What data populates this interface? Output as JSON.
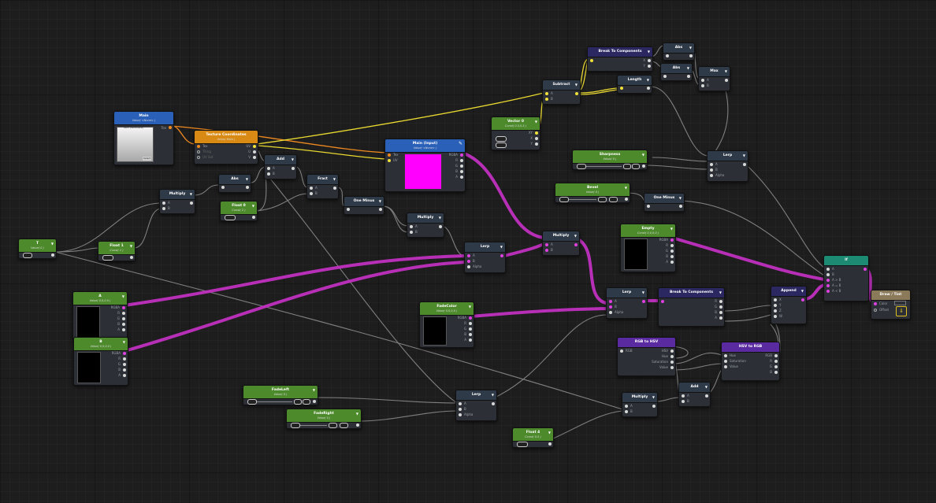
{
  "nodes": {
    "main_texture": {
      "title": "Main",
      "sub": "Value( <None> )",
      "port": "Tex",
      "tex_label": "Item (Texture2D)",
      "btn": "Select"
    },
    "texcoord": {
      "title": "Texture Coordinates",
      "sub": "Value( Main )",
      "p1": "Tex",
      "p2": "Tiling",
      "p3": "UV Set",
      "o1": "UV",
      "o2": "U",
      "o3": "V"
    },
    "main_input": {
      "title": "Main (Input)",
      "sub": "Value( <None> )",
      "in1": "Tex",
      "in2": "UV",
      "o1": "RGBA",
      "o2": "R",
      "o3": "G",
      "o4": "B",
      "o5": "A"
    },
    "add1": {
      "title": "Add",
      "a": "A",
      "b": "B"
    },
    "abs1": {
      "title": "Abs"
    },
    "frac": {
      "title": "Fract",
      "a": "A",
      "b": "B"
    },
    "multiply1": {
      "title": "Multiply",
      "a": "A",
      "b": "B"
    },
    "float0": {
      "title": "Float 0",
      "sub": "Const( 2 )"
    },
    "one_minus1": {
      "title": "One Minus"
    },
    "multiply2": {
      "title": "Multiply",
      "a": "A",
      "b": "B"
    },
    "t_param": {
      "title": "T",
      "sub": "Value( 0 )"
    },
    "float1": {
      "title": "Float 1",
      "sub": "Const( 1 )"
    },
    "lerp1": {
      "title": "Lerp",
      "a": "A",
      "b": "B",
      "c": "Alpha"
    },
    "a_color": {
      "title": "A",
      "sub": "Value( 0,0,0,0 )",
      "o1": "RGBA",
      "o2": "R",
      "o3": "G",
      "o4": "B",
      "o5": "A"
    },
    "b_color": {
      "title": "B",
      "sub": "Value( 0,0,0,0 )",
      "o1": "RGBA",
      "o2": "R",
      "o3": "G",
      "o4": "B",
      "o5": "A"
    },
    "vector0": {
      "title": "Vector 0",
      "sub": "Const( 0.5,0.5 )",
      "o1": "XY",
      "o2": "X",
      "o3": "Y"
    },
    "subtract": {
      "title": "Subtract",
      "a": "A",
      "b": "B"
    },
    "break1": {
      "title": "Break To Components",
      "o1": "X",
      "o2": "Y"
    },
    "abs2": {
      "title": "Abs"
    },
    "abs3": {
      "title": "Abs"
    },
    "length": {
      "title": "Length"
    },
    "max": {
      "title": "Max",
      "a": "A",
      "b": "B"
    },
    "sharpness": {
      "title": "Sharpness",
      "sub": "Value( 0 )"
    },
    "bevel": {
      "title": "Bevel",
      "sub": "Value( 0 )"
    },
    "lerp2": {
      "title": "Lerp",
      "a": "A",
      "b": "B",
      "c": "Alpha"
    },
    "one_minus2": {
      "title": "One Minus"
    },
    "multiply3": {
      "title": "Multiply",
      "a": "A",
      "b": "B"
    },
    "empty": {
      "title": "Empty",
      "sub": "Const( 0,0,0,0 )",
      "o1": "RGBA",
      "o2": "R",
      "o3": "G",
      "o4": "B",
      "o5": "A"
    },
    "if_node": {
      "title": "If",
      "a": "A",
      "b": "B",
      "c": "A > B",
      "d": "A = B",
      "e": "A < B"
    },
    "draw_tint": {
      "title": "Draw / Tint",
      "a": "Color",
      "b": "Offset"
    },
    "fadecolor": {
      "title": "FadeColor",
      "sub": "Value( 0,0,0,0 )",
      "o1": "RGBA",
      "o2": "R",
      "o3": "G",
      "o4": "B",
      "o5": "A"
    },
    "lerp3": {
      "title": "Lerp",
      "a": "A",
      "b": "B",
      "c": "Alpha"
    },
    "break2": {
      "title": "Break To Components",
      "o1": "R",
      "o2": "G",
      "o3": "B",
      "o4": "A"
    },
    "append": {
      "title": "Append",
      "a": "X",
      "b": "Y",
      "c": "Z",
      "d": "W"
    },
    "rgb_hsv": {
      "title": "RGB to HSV",
      "in": "RGB",
      "o1": "HSV",
      "o2": "Hue",
      "o3": "Saturation",
      "o4": "Value"
    },
    "hsv_rgb": {
      "title": "HSV to RGB",
      "in1": "Hue",
      "in2": "Saturation",
      "in3": "Value",
      "o1": "RGB",
      "o2": "R",
      "o3": "G",
      "o4": "B"
    },
    "add2": {
      "title": "Add",
      "a": "A",
      "b": "B"
    },
    "multiply4": {
      "title": "Multiply",
      "a": "A",
      "b": "B"
    },
    "fadeleft": {
      "title": "FadeLeft",
      "sub": "Value( 0 )"
    },
    "faderight": {
      "title": "FadeRight",
      "sub": "Value( 0 )"
    },
    "lerp4": {
      "title": "Lerp",
      "a": "A",
      "b": "B",
      "c": "Alpha"
    },
    "float4": {
      "title": "Float 4",
      "sub": "Const( 0.5 )"
    }
  },
  "colors": {
    "wire_gray": "#8a8a8a",
    "wire_magenta": "#c030c0",
    "wire_yellow": "#e8d830",
    "wire_orange": "#e07a18",
    "preview_magenta": "#ff00ff"
  }
}
